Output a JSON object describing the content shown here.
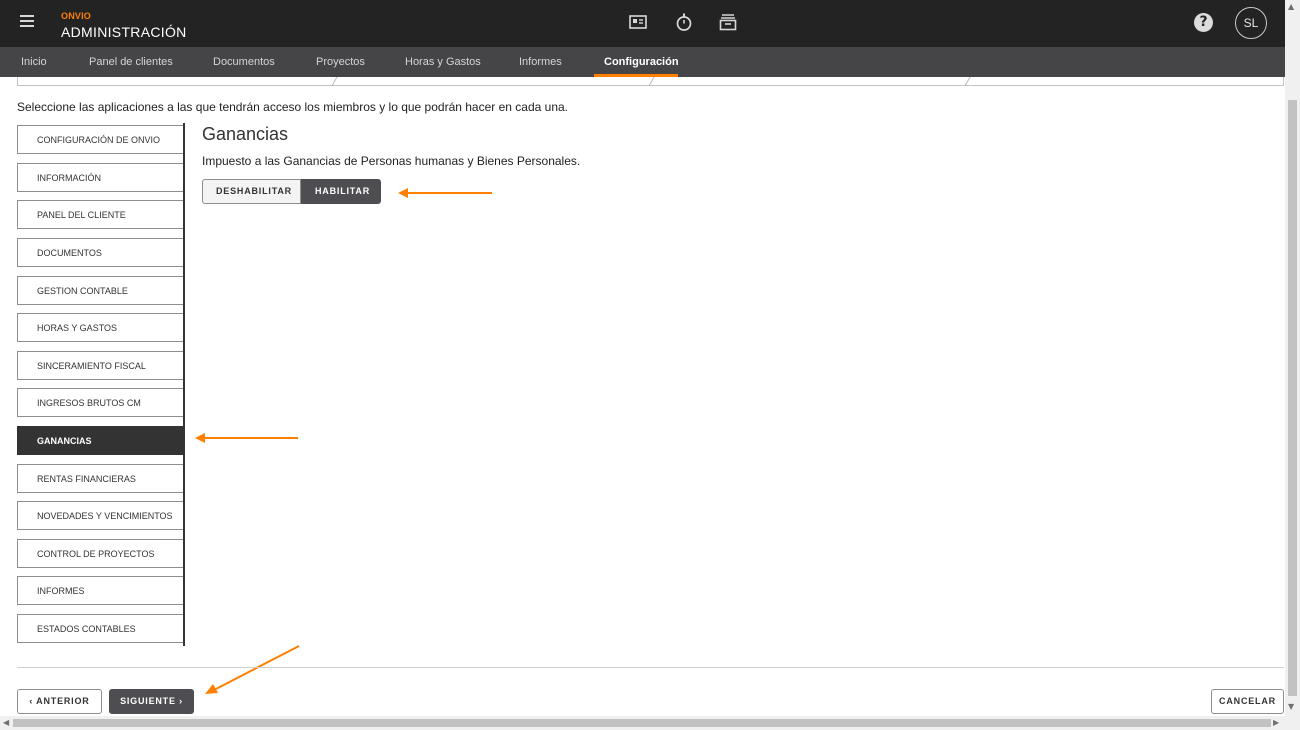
{
  "header": {
    "brand_small": "ONVIO",
    "brand_title": "ADMINISTRACIÓN",
    "icons": [
      "id-card-icon",
      "stopwatch-icon",
      "archive-tray-icon"
    ],
    "help_label": "?",
    "avatar_initials": "SL"
  },
  "nav": {
    "items": [
      {
        "label": "Inicio"
      },
      {
        "label": "Panel de clientes"
      },
      {
        "label": "Documentos"
      },
      {
        "label": "Proyectos"
      },
      {
        "label": "Horas y Gastos"
      },
      {
        "label": "Informes"
      },
      {
        "label": "Configuración",
        "active": true
      }
    ],
    "accent_color": "#ff8000"
  },
  "instruction": "Seleccione las aplicaciones a las que tendrán acceso los miembros y lo que podrán hacer en cada una.",
  "app_menu": {
    "items": [
      {
        "label": "CONFIGURACIÓN DE ONVIO"
      },
      {
        "label": "INFORMACIÓN"
      },
      {
        "label": "PANEL DEL CLIENTE"
      },
      {
        "label": "DOCUMENTOS"
      },
      {
        "label": "GESTION CONTABLE"
      },
      {
        "label": "HORAS Y GASTOS"
      },
      {
        "label": "SINCERAMIENTO FISCAL"
      },
      {
        "label": "INGRESOS BRUTOS CM"
      },
      {
        "label": "GANANCIAS",
        "active": true
      },
      {
        "label": "RENTAS FINANCIERAS"
      },
      {
        "label": "NOVEDADES Y VENCIMIENTOS"
      },
      {
        "label": "CONTROL DE PROYECTOS"
      },
      {
        "label": "INFORMES"
      },
      {
        "label": "ESTADOS CONTABLES"
      }
    ]
  },
  "content": {
    "title": "Ganancias",
    "description": "Impuesto a las Ganancias de Personas humanas y Bienes Personales.",
    "toggle": {
      "disable_label": "DESHABILITAR",
      "enable_label": "HABILITAR",
      "selected": "HABILITAR"
    }
  },
  "footer": {
    "prev_label": "ANTERIOR",
    "next_label": "SIGUIENTE",
    "cancel_label": "CANCELAR"
  },
  "colors": {
    "header_bg": "#232323",
    "nav_bg": "#454547",
    "active_menu_bg": "#333333",
    "button_dark": "#4d4d52",
    "annotation_arrow": "#ff8000"
  }
}
